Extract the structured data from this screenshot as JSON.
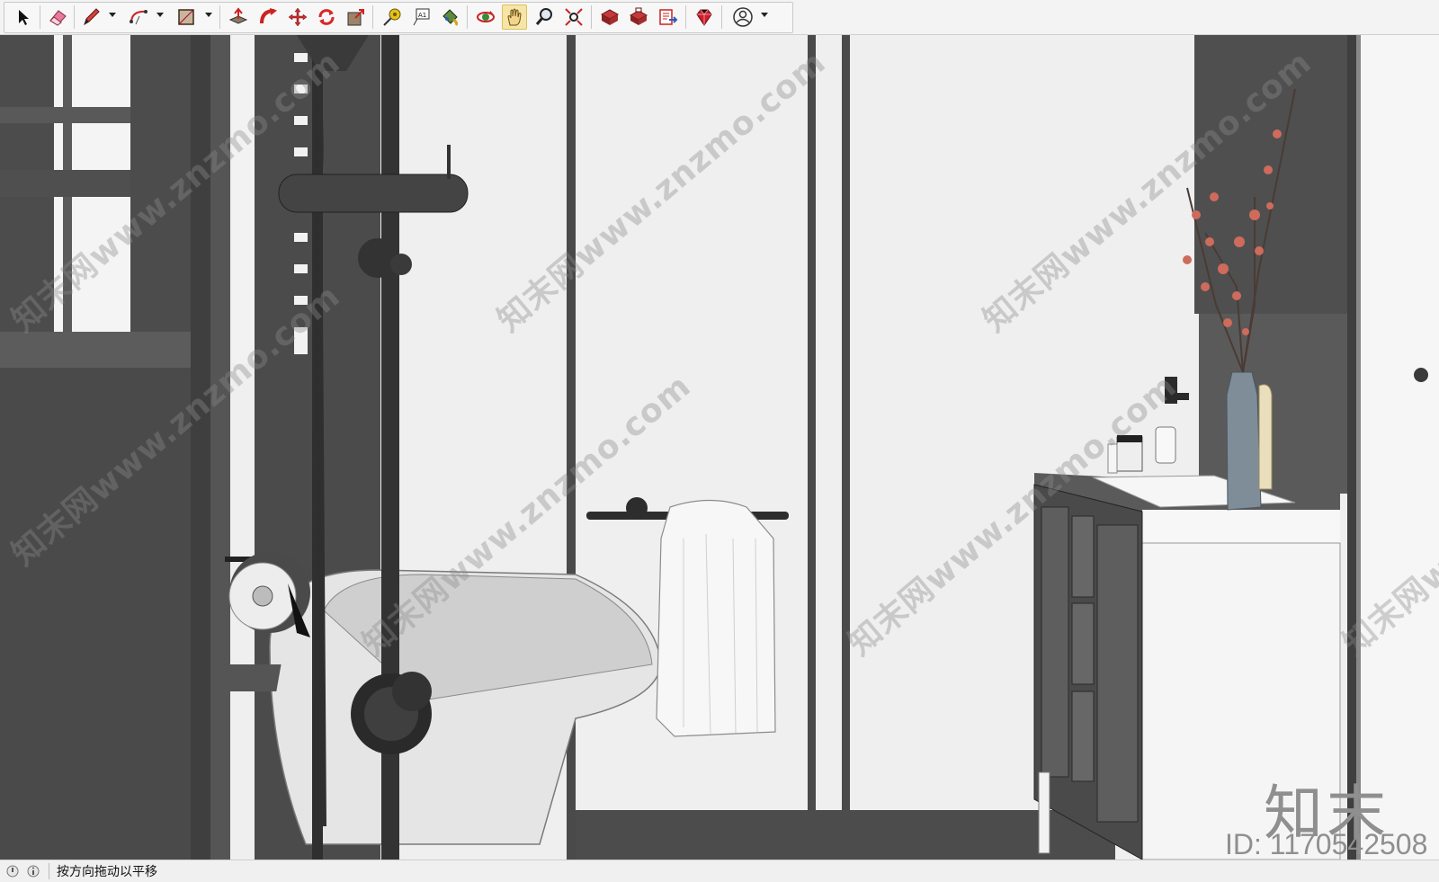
{
  "toolbar": {
    "tools": [
      {
        "name": "select-tool",
        "icon": "arrow-cursor-icon"
      },
      {
        "name": "eraser-tool",
        "icon": "eraser-icon"
      },
      {
        "name": "pencil-tool",
        "icon": "pencil-icon",
        "has_dropdown": true
      },
      {
        "name": "arc-tool",
        "icon": "arc-icon",
        "has_dropdown": true
      },
      {
        "name": "shape-tool",
        "icon": "rectangle-icon",
        "has_dropdown": true
      },
      {
        "name": "push-pull-tool",
        "icon": "push-pull-icon"
      },
      {
        "name": "follow-me-tool",
        "icon": "follow-me-icon"
      },
      {
        "name": "move-tool",
        "icon": "move-icon"
      },
      {
        "name": "rotate-tool",
        "icon": "rotate-icon"
      },
      {
        "name": "scale-tool",
        "icon": "scale-icon"
      },
      {
        "name": "tape-measure-tool",
        "icon": "tape-measure-icon"
      },
      {
        "name": "text-tool",
        "icon": "text-icon",
        "label": "A1"
      },
      {
        "name": "paint-bucket-tool",
        "icon": "paint-bucket-icon"
      },
      {
        "name": "orbit-tool",
        "icon": "orbit-icon"
      },
      {
        "name": "pan-tool",
        "icon": "pan-hand-icon",
        "active": true
      },
      {
        "name": "zoom-tool",
        "icon": "zoom-icon"
      },
      {
        "name": "zoom-extents-tool",
        "icon": "zoom-extents-icon"
      },
      {
        "name": "warehouse-tool",
        "icon": "warehouse-icon"
      },
      {
        "name": "extension-warehouse-tool",
        "icon": "extension-warehouse-icon"
      },
      {
        "name": "layout-tool",
        "icon": "send-to-layout-icon"
      },
      {
        "name": "ruby-console-tool",
        "icon": "ruby-icon"
      },
      {
        "name": "account-tool",
        "icon": "user-account-icon",
        "has_dropdown": true
      }
    ],
    "accent_color": "#f5e6a8"
  },
  "viewport": {
    "watermark_text": "知末网www.znzmo.com",
    "brand_mark": "知末",
    "asset_id": "ID: 1170542508"
  },
  "status": {
    "text": "按方向拖动以平移"
  }
}
